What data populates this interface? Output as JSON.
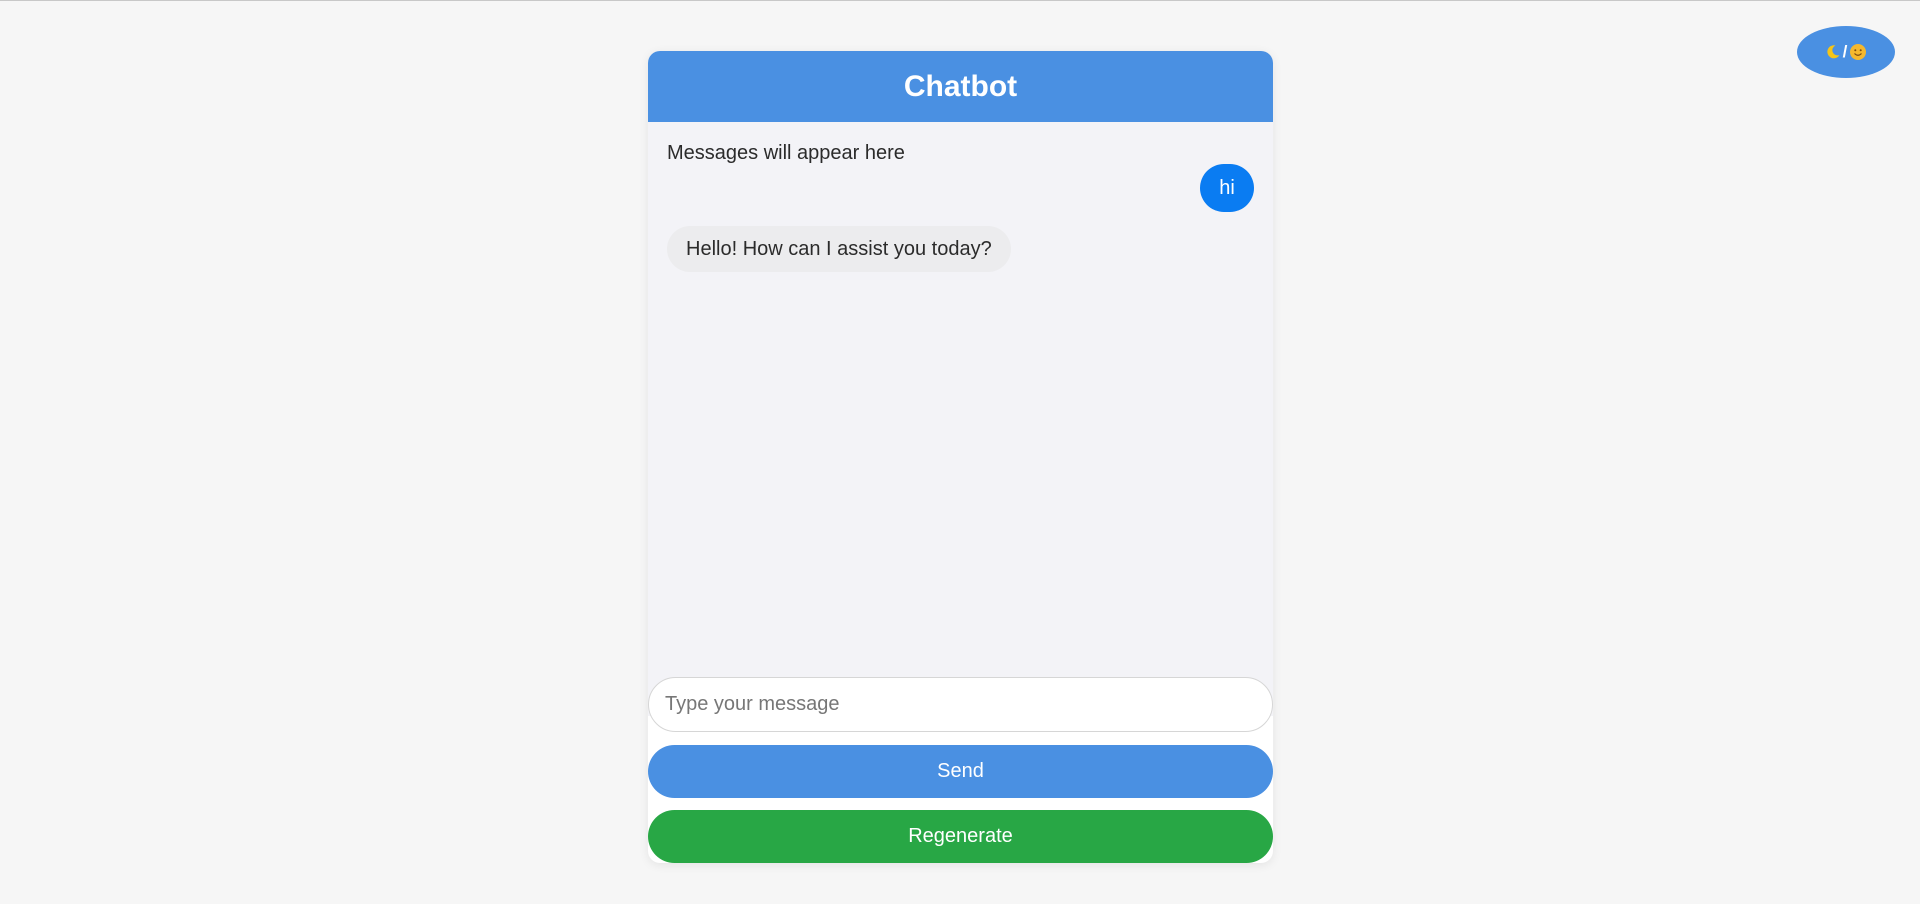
{
  "theme_toggle": {
    "separator": "/",
    "moon_icon": "moon-icon",
    "sun_icon": "sun-icon"
  },
  "chat": {
    "title": "Chatbot",
    "placeholder_text": "Messages will appear here",
    "messages": [
      {
        "role": "user",
        "text": "hi"
      },
      {
        "role": "bot",
        "text": "Hello! How can I assist you today?"
      }
    ],
    "input": {
      "value": "",
      "placeholder": "Type your message"
    },
    "send_label": "Send",
    "regenerate_label": "Regenerate"
  },
  "colors": {
    "accent": "#4a90e2",
    "user_bubble": "#0a7cf2",
    "regenerate": "#28a745",
    "background": "#f6f6f6"
  }
}
